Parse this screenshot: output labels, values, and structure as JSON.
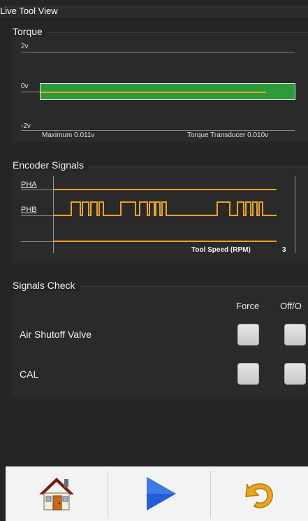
{
  "window": {
    "title": "Live Tool View"
  },
  "torque": {
    "label": "Torque",
    "axis": [
      "2v",
      "0v",
      "-2v"
    ],
    "maximum": "Maximum 0.011v",
    "transducer": "Torque Transducer 0.010v"
  },
  "encoder": {
    "label": "Encoder Signals",
    "channels": [
      "PHA",
      "PHB"
    ],
    "speed_label": "Tool Speed (RPM)",
    "speed_value": "3"
  },
  "signals": {
    "label": "Signals Check",
    "columns": [
      "Force",
      "Off/O"
    ],
    "rows": [
      "Air Shutoff Valve",
      "CAL"
    ]
  },
  "colors": {
    "signal": "#e8a32a",
    "torque_bar": "#2a9a3a"
  },
  "footer": {
    "icons": [
      "home-icon",
      "play-icon",
      "undo-icon"
    ]
  }
}
